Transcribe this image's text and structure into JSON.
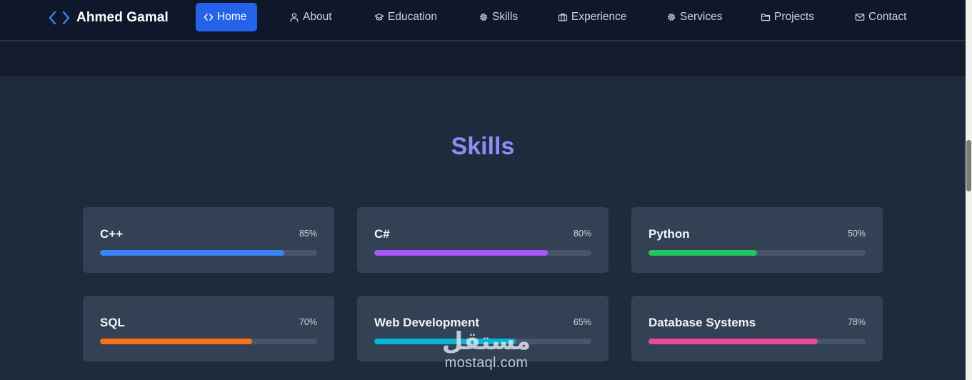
{
  "brand": {
    "name": "Ahmed Gamal",
    "icon": "code-brackets-icon",
    "color": "#3b82f6"
  },
  "nav": {
    "active_color": "#2563eb",
    "items": [
      {
        "label": "Home",
        "icon": "code-icon",
        "active": true
      },
      {
        "label": "About",
        "icon": "user-icon",
        "active": false
      },
      {
        "label": "Education",
        "icon": "graduation-cap-icon",
        "active": false
      },
      {
        "label": "Skills",
        "icon": "gear-icon",
        "active": false
      },
      {
        "label": "Experience",
        "icon": "briefcase-icon",
        "active": false
      },
      {
        "label": "Services",
        "icon": "gear-icon",
        "active": false
      },
      {
        "label": "Projects",
        "icon": "folder-icon",
        "active": false
      },
      {
        "label": "Contact",
        "icon": "mail-icon",
        "active": false
      }
    ]
  },
  "skills_section": {
    "title": "Skills",
    "title_color": "#8b8ef3",
    "skills": [
      {
        "name": "C++",
        "percent_label": "85%",
        "level": 0.85,
        "color": "#3b82f6"
      },
      {
        "name": "C#",
        "percent_label": "80%",
        "level": 0.8,
        "color": "#a855f7"
      },
      {
        "name": "Python",
        "percent_label": "50%",
        "level": 0.5,
        "color": "#22c55e"
      },
      {
        "name": "SQL",
        "percent_label": "70%",
        "level": 0.7,
        "color": "#f97316"
      },
      {
        "name": "Web Development",
        "percent_label": "65%",
        "level": 0.65,
        "color": "#06b6d4"
      },
      {
        "name": "Database Systems",
        "percent_label": "78%",
        "level": 0.78,
        "color": "#ec4899"
      }
    ]
  },
  "watermark": {
    "arabic": "مستقل",
    "latin": "mostaql.com"
  }
}
